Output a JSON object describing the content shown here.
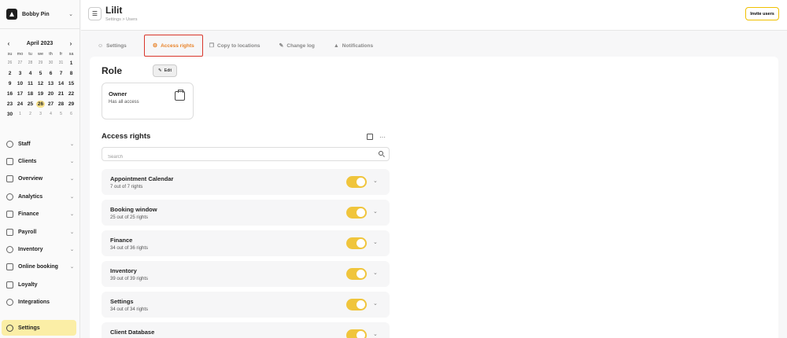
{
  "sidebar": {
    "business_name": "Bobby Pin",
    "calendar": {
      "month": "April 2023",
      "weekdays": [
        "su",
        "mo",
        "tu",
        "we",
        "th",
        "fr",
        "sa"
      ],
      "days": [
        {
          "d": "26",
          "o": true
        },
        {
          "d": "27",
          "o": true
        },
        {
          "d": "28",
          "o": true
        },
        {
          "d": "29",
          "o": true
        },
        {
          "d": "30",
          "o": true
        },
        {
          "d": "31",
          "o": true
        },
        {
          "d": "1"
        },
        {
          "d": "2"
        },
        {
          "d": "3"
        },
        {
          "d": "4"
        },
        {
          "d": "5"
        },
        {
          "d": "6"
        },
        {
          "d": "7"
        },
        {
          "d": "8"
        },
        {
          "d": "9"
        },
        {
          "d": "10"
        },
        {
          "d": "11"
        },
        {
          "d": "12"
        },
        {
          "d": "13"
        },
        {
          "d": "14"
        },
        {
          "d": "15"
        },
        {
          "d": "16"
        },
        {
          "d": "17"
        },
        {
          "d": "18"
        },
        {
          "d": "19"
        },
        {
          "d": "20"
        },
        {
          "d": "21"
        },
        {
          "d": "22"
        },
        {
          "d": "23"
        },
        {
          "d": "24"
        },
        {
          "d": "25"
        },
        {
          "d": "26",
          "today": true
        },
        {
          "d": "27"
        },
        {
          "d": "28"
        },
        {
          "d": "29"
        },
        {
          "d": "30"
        },
        {
          "d": "1",
          "o": true
        },
        {
          "d": "2",
          "o": true
        },
        {
          "d": "3",
          "o": true
        },
        {
          "d": "4",
          "o": true
        },
        {
          "d": "5",
          "o": true
        },
        {
          "d": "6",
          "o": true
        }
      ]
    },
    "nav": [
      {
        "label": "Staff",
        "chevron": true,
        "icon": "person-icon"
      },
      {
        "label": "Clients",
        "chevron": true,
        "icon": "people-icon"
      },
      {
        "label": "Overview",
        "chevron": true,
        "icon": "grid-icon"
      },
      {
        "label": "Analytics",
        "chevron": true,
        "icon": "chart-icon"
      },
      {
        "label": "Finance",
        "chevron": true,
        "icon": "dollar-icon"
      },
      {
        "label": "Payroll",
        "chevron": true,
        "icon": "wallet-icon"
      },
      {
        "label": "Inventory",
        "chevron": true,
        "icon": "box-icon"
      },
      {
        "label": "Online booking",
        "chevron": true,
        "icon": "globe-icon"
      },
      {
        "label": "Loyalty",
        "chevron": false,
        "icon": "badge-icon"
      },
      {
        "label": "Integrations",
        "chevron": false,
        "icon": "building-icon"
      }
    ],
    "active_item": {
      "label": "Settings",
      "icon": "gear-icon"
    }
  },
  "header": {
    "title": "Lilit",
    "breadcrumb": [
      "Settings",
      ">",
      "Users"
    ],
    "invite_label": "Invite users"
  },
  "tabs": [
    {
      "label": "Settings",
      "icon": "person-icon",
      "active": false
    },
    {
      "label": "Access rights",
      "icon": "key-icon",
      "active": true
    },
    {
      "label": "Copy to locations",
      "icon": "copy-icon",
      "active": false
    },
    {
      "label": "Change log",
      "icon": "edit-icon",
      "active": false
    },
    {
      "label": "Notifications",
      "icon": "bell-icon",
      "active": false
    }
  ],
  "role": {
    "title": "Role",
    "edit_label": "Edit",
    "name": "Owner",
    "description": "Has all access"
  },
  "access_rights": {
    "title": "Access rights",
    "search_placeholder": "Search",
    "items": [
      {
        "name": "Appointment Calendar",
        "count": "7 out of 7 rights",
        "enabled": true
      },
      {
        "name": "Booking window",
        "count": "25 out of 25 rights",
        "enabled": true
      },
      {
        "name": "Finance",
        "count": "34 out of 36 rights",
        "enabled": true
      },
      {
        "name": "Inventory",
        "count": "39 out of 39 rights",
        "enabled": true
      },
      {
        "name": "Settings",
        "count": "34 out of 34 rights",
        "enabled": true
      },
      {
        "name": "Client Database",
        "count": "",
        "enabled": true
      }
    ]
  }
}
